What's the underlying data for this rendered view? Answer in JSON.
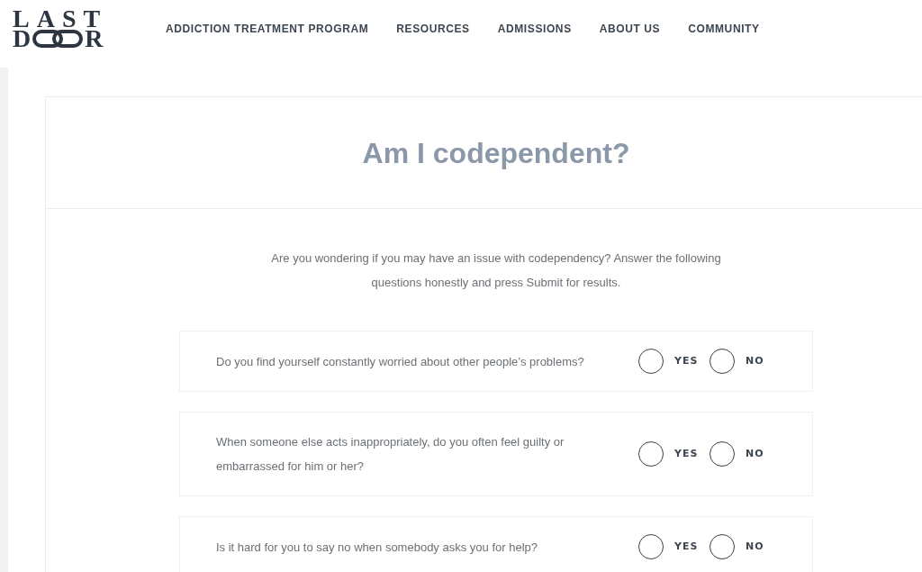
{
  "header": {
    "logo": {
      "line_1": "LAST",
      "line_2_start": "D",
      "line_2_end": "R"
    },
    "nav": [
      "ADDICTION TREATMENT PROGRAM",
      "RESOURCES",
      "ADMISSIONS",
      "ABOUT US",
      "COMMUNITY"
    ]
  },
  "quiz": {
    "title": "Am I codependent?",
    "intro": "Are you wondering if you may have an issue with codependency? Answer the following questions honestly and press Submit for results.",
    "questions": [
      {
        "text": "Do you find yourself constantly worried about other people’s problems?",
        "options": [
          {
            "label": "YES",
            "selected": false
          },
          {
            "label": "NO",
            "selected": false
          }
        ]
      },
      {
        "text": "When someone else acts inappropriately, do you often feel guilty or embarrassed for him or her?",
        "options": [
          {
            "label": "YES",
            "selected": false
          },
          {
            "label": "NO",
            "selected": false
          }
        ]
      },
      {
        "text": "Is it hard for you to say no when somebody asks you for help?",
        "options": [
          {
            "label": "YES",
            "selected": false
          },
          {
            "label": "NO",
            "selected": false
          }
        ]
      }
    ]
  }
}
